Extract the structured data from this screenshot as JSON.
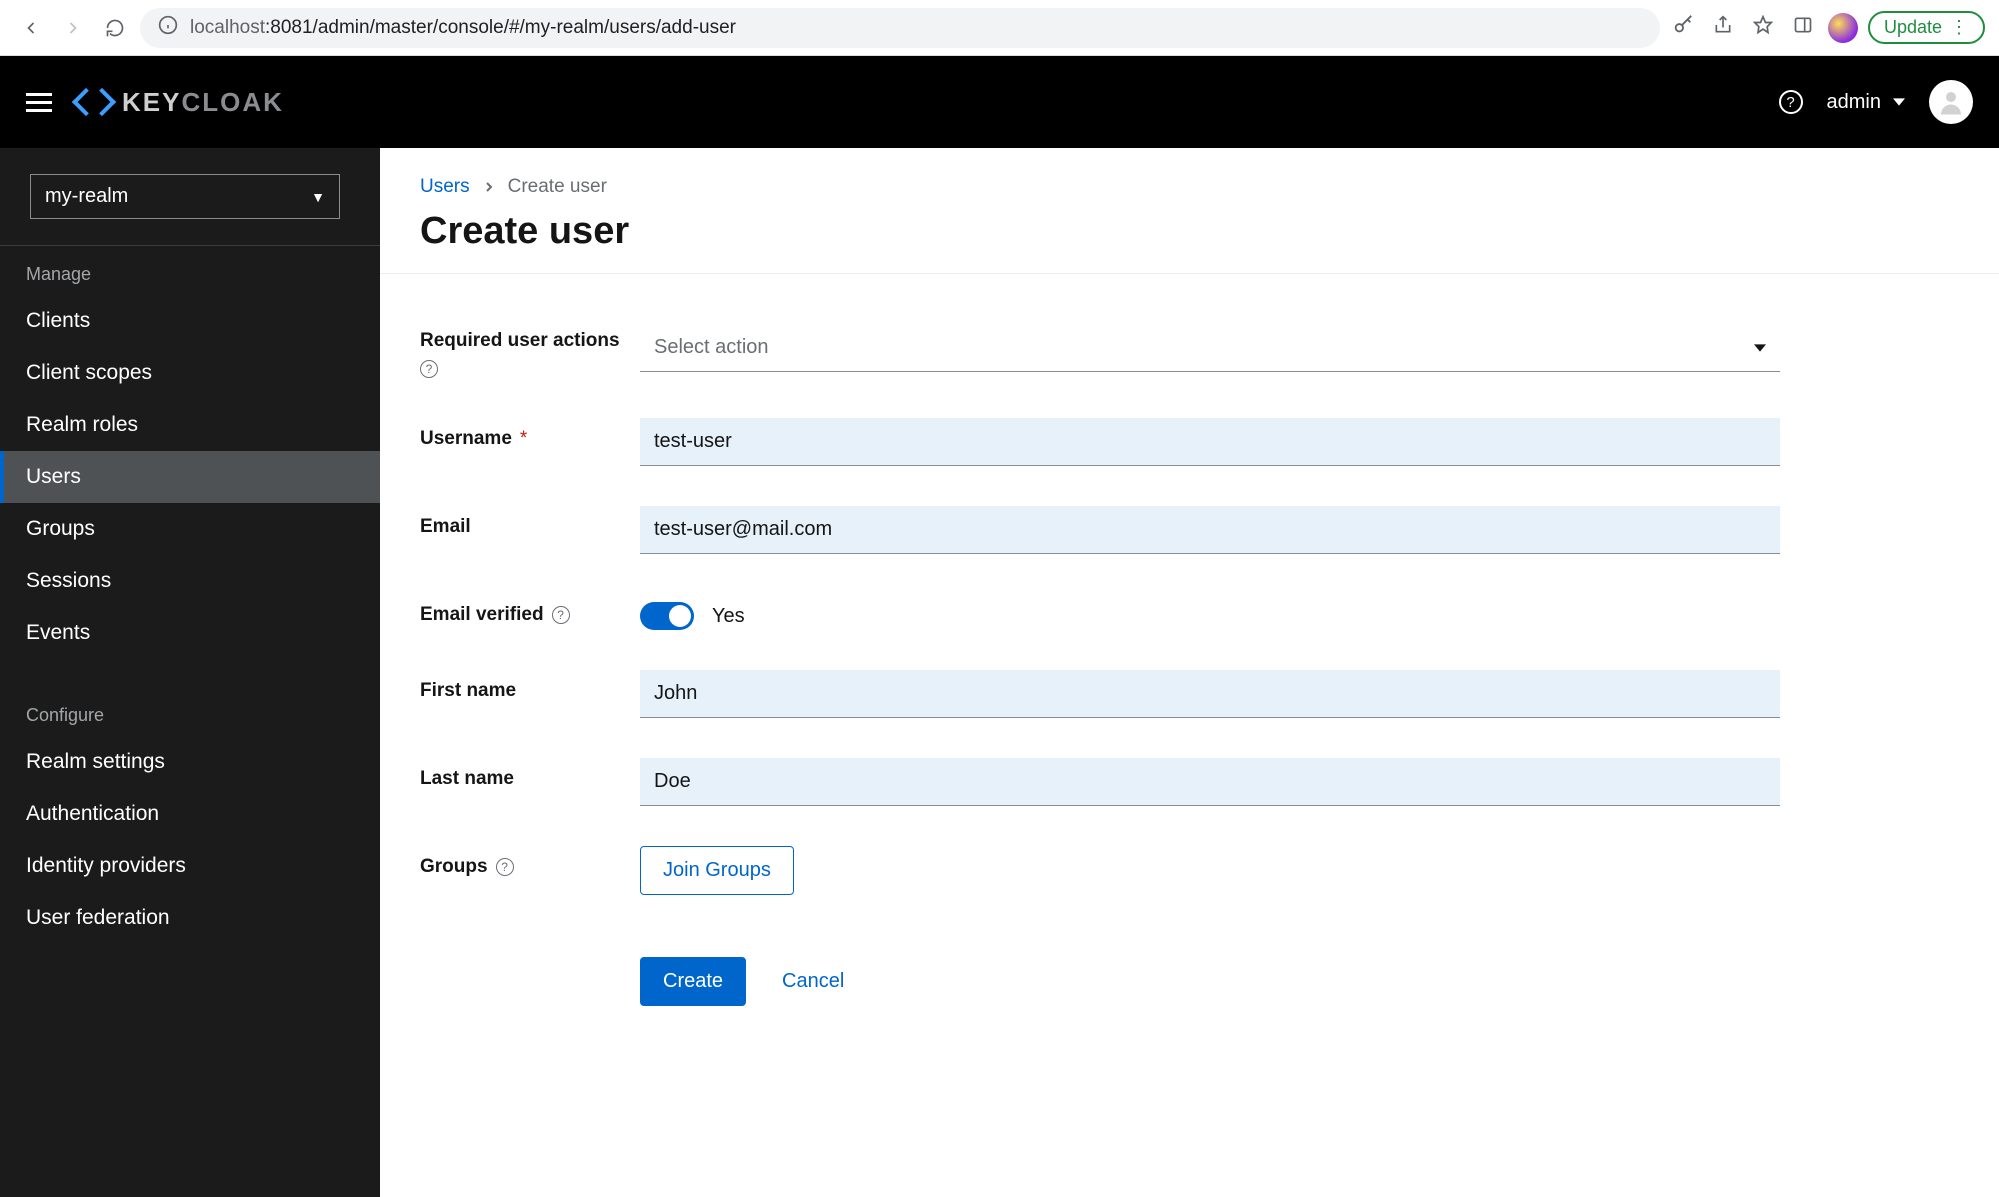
{
  "browser": {
    "url_host_dim": "localhost",
    "url_rest": ":8081/admin/master/console/#/my-realm/users/add-user",
    "update_label": "Update"
  },
  "header": {
    "logo_main": "KEY",
    "logo_sub": "CLOAK",
    "user_label": "admin"
  },
  "sidebar": {
    "realm_selected": "my-realm",
    "section_manage": "Manage",
    "section_configure": "Configure",
    "manage_items": [
      {
        "label": "Clients",
        "active": false
      },
      {
        "label": "Client scopes",
        "active": false
      },
      {
        "label": "Realm roles",
        "active": false
      },
      {
        "label": "Users",
        "active": true
      },
      {
        "label": "Groups",
        "active": false
      },
      {
        "label": "Sessions",
        "active": false
      },
      {
        "label": "Events",
        "active": false
      }
    ],
    "configure_items": [
      {
        "label": "Realm settings"
      },
      {
        "label": "Authentication"
      },
      {
        "label": "Identity providers"
      },
      {
        "label": "User federation"
      }
    ]
  },
  "breadcrumb": {
    "parent": "Users",
    "current": "Create user"
  },
  "page": {
    "title": "Create user"
  },
  "form": {
    "required_actions": {
      "label": "Required user actions",
      "placeholder": "Select action"
    },
    "username": {
      "label": "Username",
      "value": "test-user"
    },
    "email": {
      "label": "Email",
      "value": "test-user@mail.com"
    },
    "email_verified": {
      "label": "Email verified",
      "value_label": "Yes"
    },
    "first_name": {
      "label": "First name",
      "value": "John"
    },
    "last_name": {
      "label": "Last name",
      "value": "Doe"
    },
    "groups": {
      "label": "Groups",
      "button": "Join Groups"
    },
    "actions": {
      "create": "Create",
      "cancel": "Cancel"
    }
  }
}
